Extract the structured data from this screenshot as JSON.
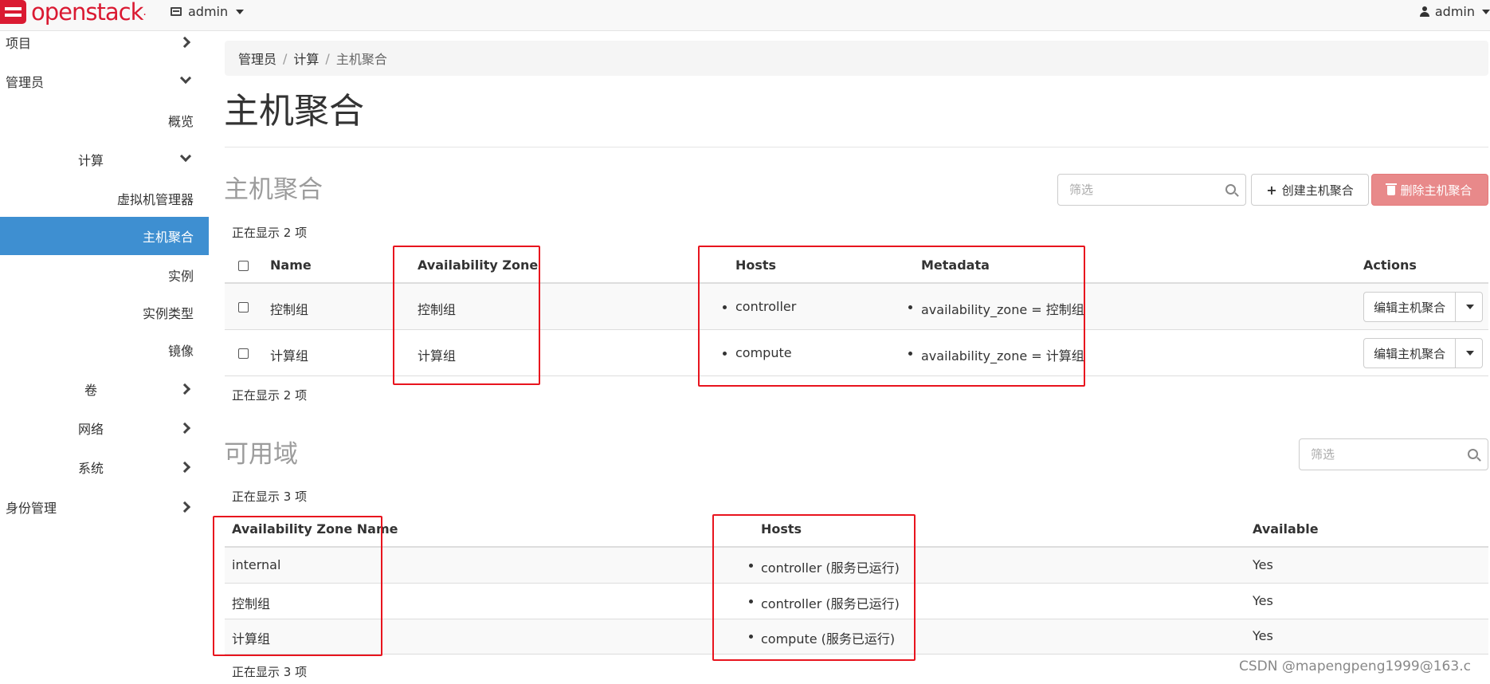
{
  "header": {
    "brand": "openstack",
    "brand_suffix": ".",
    "project": "admin",
    "user": "admin"
  },
  "sidebar": {
    "items": [
      {
        "label": "项目"
      },
      {
        "label": "管理员"
      },
      {
        "label": "概览"
      },
      {
        "label": "计算"
      },
      {
        "label": "虚拟机管理器"
      },
      {
        "label": "主机聚合"
      },
      {
        "label": "实例"
      },
      {
        "label": "实例类型"
      },
      {
        "label": "镜像"
      },
      {
        "label": "卷"
      },
      {
        "label": "网络"
      },
      {
        "label": "系统"
      },
      {
        "label": "身份管理"
      }
    ]
  },
  "breadcrumb": {
    "items": [
      "管理员",
      "计算",
      "主机聚合"
    ],
    "separator": "/"
  },
  "page": {
    "title": "主机聚合"
  },
  "aggregates": {
    "title": "主机聚合",
    "filter_placeholder": "筛选",
    "create_label": "创建主机聚合",
    "delete_label": "删除主机聚合",
    "count_text": "正在显示 2 项",
    "columns": [
      "Name",
      "Availability Zone",
      "Hosts",
      "Metadata",
      "Actions"
    ],
    "rows": [
      {
        "name": "控制组",
        "zone": "控制组",
        "host": "controller",
        "metadata": "availability_zone = 控制组",
        "action": "编辑主机聚合"
      },
      {
        "name": "计算组",
        "zone": "计算组",
        "host": "compute",
        "metadata": "availability_zone = 计算组",
        "action": "编辑主机聚合"
      }
    ]
  },
  "zones": {
    "title": "可用域",
    "filter_placeholder": "筛选",
    "count_text": "正在显示 3 项",
    "columns": [
      "Availability Zone Name",
      "Hosts",
      "Available"
    ],
    "rows": [
      {
        "name": "internal",
        "host": "controller (服务已运行)",
        "available": "Yes"
      },
      {
        "name": "控制组",
        "host": "controller (服务已运行)",
        "available": "Yes"
      },
      {
        "name": "计算组",
        "host": "compute (服务已运行)",
        "available": "Yes"
      }
    ]
  },
  "watermark": "CSDN @mapengpeng1999@163.c",
  "colors": {
    "brand_red": "#da1a32",
    "nav_active": "#3e8fd1",
    "danger_button": "#e8898a",
    "annotation_red": "#e8141e"
  }
}
